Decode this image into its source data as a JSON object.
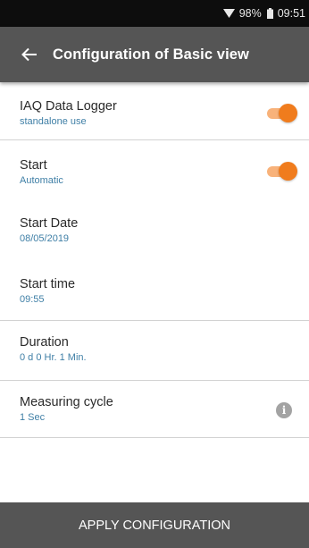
{
  "status_bar": {
    "battery": "98%",
    "time": "09:51",
    "wifi_icon": "wifi-icon",
    "battery_icon": "battery-icon"
  },
  "header": {
    "title": "Configuration of Basic view",
    "back_icon": "arrow-left-icon"
  },
  "settings": {
    "data_logger": {
      "label": "IAQ Data Logger",
      "value": "standalone use",
      "toggle_on": true
    },
    "start": {
      "label": "Start",
      "value": "Automatic",
      "toggle_on": true
    },
    "start_date": {
      "label": "Start Date",
      "value": "08/05/2019"
    },
    "start_time": {
      "label": "Start time",
      "value": "09:55"
    },
    "duration": {
      "label": "Duration",
      "value": "0 d 0 Hr. 1 Min."
    },
    "measuring_cycle": {
      "label": "Measuring cycle",
      "value": "1 Sec",
      "info_icon": "info-icon"
    }
  },
  "footer": {
    "apply_label": "APPLY CONFIGURATION"
  },
  "colors": {
    "accent": "#f07c1d",
    "accent_light": "#f8b27a",
    "header_bg": "#555555",
    "value_text": "#3f7fa6"
  }
}
